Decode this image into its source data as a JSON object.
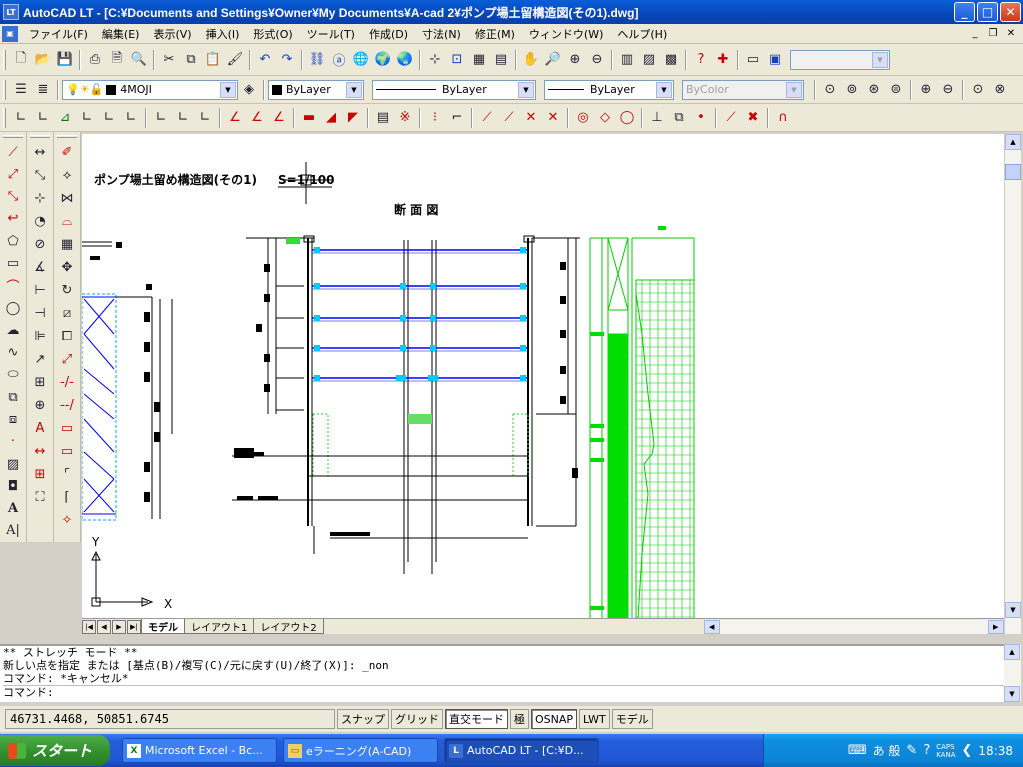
{
  "window": {
    "app_icon": "LT",
    "title": "AutoCAD LT - [C:¥Documents and Settings¥Owner¥My Documents¥A-cad 2¥ポンプ場土留構造図(その1).dwg]",
    "minimize": "_",
    "maximize": "□",
    "close": "✕"
  },
  "menubar": {
    "items": [
      "ファイル(F)",
      "編集(E)",
      "表示(V)",
      "挿入(I)",
      "形式(O)",
      "ツール(T)",
      "作成(D)",
      "寸法(N)",
      "修正(M)",
      "ウィンドウ(W)",
      "ヘルプ(H)"
    ],
    "mdi_buttons": [
      "_",
      "❐",
      "✕"
    ]
  },
  "layers_toolbar": {
    "layer_name": "4MOJI",
    "color": "ByLayer",
    "linetype": "ByLayer",
    "lineweight": "ByLayer",
    "plot_style": "ByColor"
  },
  "drawing": {
    "title": "ポンプ場土留め構造図(その1)",
    "scale": "S=1/100",
    "section_label": "断 面 図",
    "ucs_y": "Y",
    "ucs_x": "X"
  },
  "layout_tabs": [
    "モデル",
    "レイアウト1",
    "レイアウト2"
  ],
  "command": {
    "lines": [
      "** ストレッチ モード **",
      "新しい点を指定 または [基点(B)/複写(C)/元に戻す(U)/終了(X)]: _non",
      "コマンド: *キャンセル*"
    ],
    "prompt": "コマンド:"
  },
  "status": {
    "coordinates": "46731.4468, 50851.6745",
    "buttons": [
      "スナップ",
      "グリッド",
      "直交モード",
      "極",
      "OSNAP",
      "LWT",
      "モデル"
    ]
  },
  "taskbar": {
    "start": "スタート",
    "tasks": [
      "Microsoft Excel - Bc...",
      "eラーニング(A-CAD)",
      "AutoCAD LT - [C:¥D..."
    ],
    "tray_ime": "あ 般",
    "caps": "CAPS",
    "kana": "KANA",
    "clock": "18:38"
  }
}
